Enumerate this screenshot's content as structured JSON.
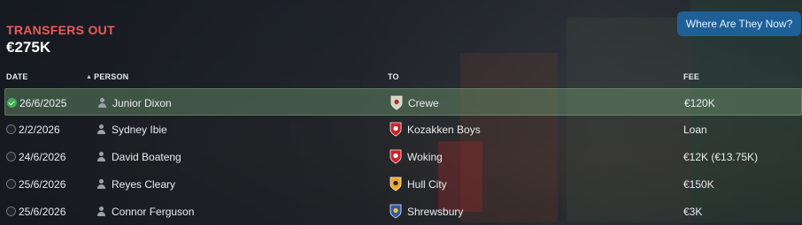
{
  "panel": {
    "title": "TRANSFERS OUT",
    "total": "€275K",
    "where_button": "Where Are They Now?"
  },
  "columns": {
    "date": "DATE",
    "person": "PERSON",
    "to": "TO",
    "fee": "FEE"
  },
  "rows": [
    {
      "date": "26/6/2025",
      "person": "Junior Dixon",
      "club": "Crewe",
      "fee": "€120K",
      "selected": true,
      "badge_color": "#d8d2c4",
      "badge_accent": "#b22a2a"
    },
    {
      "date": "2/2/2026",
      "person": "Sydney Ibie",
      "club": "Kozakken Boys",
      "fee": "Loan",
      "selected": false,
      "badge_color": "#c8252a",
      "badge_accent": "#ffffff"
    },
    {
      "date": "24/6/2026",
      "person": "David Boateng",
      "club": "Woking",
      "fee": "€12K (€13.75K)",
      "selected": false,
      "badge_color": "#d4232b",
      "badge_accent": "#ffffff"
    },
    {
      "date": "25/6/2026",
      "person": "Reyes Cleary",
      "club": "Hull City",
      "fee": "€150K",
      "selected": false,
      "badge_color": "#f2a51d",
      "badge_accent": "#222222"
    },
    {
      "date": "25/6/2026",
      "person": "Connor Ferguson",
      "club": "Shrewsbury",
      "fee": "€3K",
      "selected": false,
      "badge_color": "#2e5aa8",
      "badge_accent": "#f2c230"
    }
  ]
}
